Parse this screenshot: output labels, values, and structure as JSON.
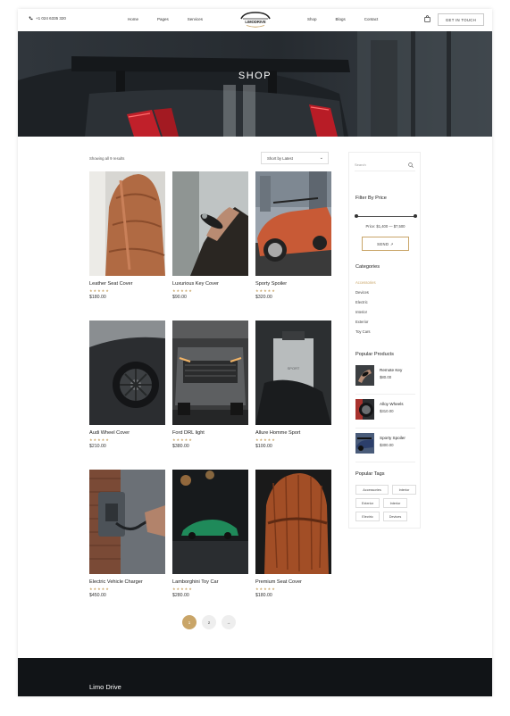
{
  "header": {
    "phone": "+1 024 6335 320",
    "nav_left": [
      "Home",
      "Pages",
      "Services"
    ],
    "nav_right": [
      "Shop",
      "Blogs",
      "Contact"
    ],
    "logo_text": "LIMODRIVE",
    "cta_label": "GET IN TOUCH"
  },
  "hero": {
    "title": "SHOP"
  },
  "shop": {
    "results_text": "Showing all 9 results",
    "sort_value": "Short by Latest",
    "stars": "★★★★★",
    "products": [
      {
        "name": "Leather Seat Cover",
        "price": "$180.00"
      },
      {
        "name": "Luxurious Key Cover",
        "price": "$90.00"
      },
      {
        "name": "Sporty Spoiler",
        "price": "$320.00"
      },
      {
        "name": "Audi Wheel Cover",
        "price": "$210.00"
      },
      {
        "name": "Ford DRL light",
        "price": "$380.00"
      },
      {
        "name": "Allure Homme Sport",
        "price": "$100.00"
      },
      {
        "name": "Electric Vehicle Charger",
        "price": "$450.00"
      },
      {
        "name": "Lamborghini Toy Car",
        "price": "$280.00"
      },
      {
        "name": "Premium Seat Cover",
        "price": "$180.00"
      }
    ],
    "pagination": [
      "1",
      "2",
      "→"
    ]
  },
  "sidebar": {
    "search_placeholder": "Search",
    "filter_title": "Filter By Price",
    "price_range": "Price: $1,400 — $7,500",
    "send_label": "SEND ↗",
    "categories_title": "Categories",
    "categories": [
      "Accessories",
      "Devices",
      "Electric",
      "Interior",
      "Exterior",
      "Toy Cars"
    ],
    "popular_title": "Popular Products",
    "popular": [
      {
        "name": "Remote Key",
        "price": "$80.00"
      },
      {
        "name": "Alloy Wheels",
        "price": "$310.00"
      },
      {
        "name": "Sporty Spoiler",
        "price": "$300.00"
      }
    ],
    "tags_title": "Popular Tags",
    "tags": [
      "Accessories",
      "Interior",
      "Exterior",
      "Interior",
      "Electric",
      "Devices"
    ]
  },
  "footer": {
    "brand": "Limo Drive"
  },
  "colors": {
    "accent": "#c9a568",
    "dark": "#111417"
  }
}
